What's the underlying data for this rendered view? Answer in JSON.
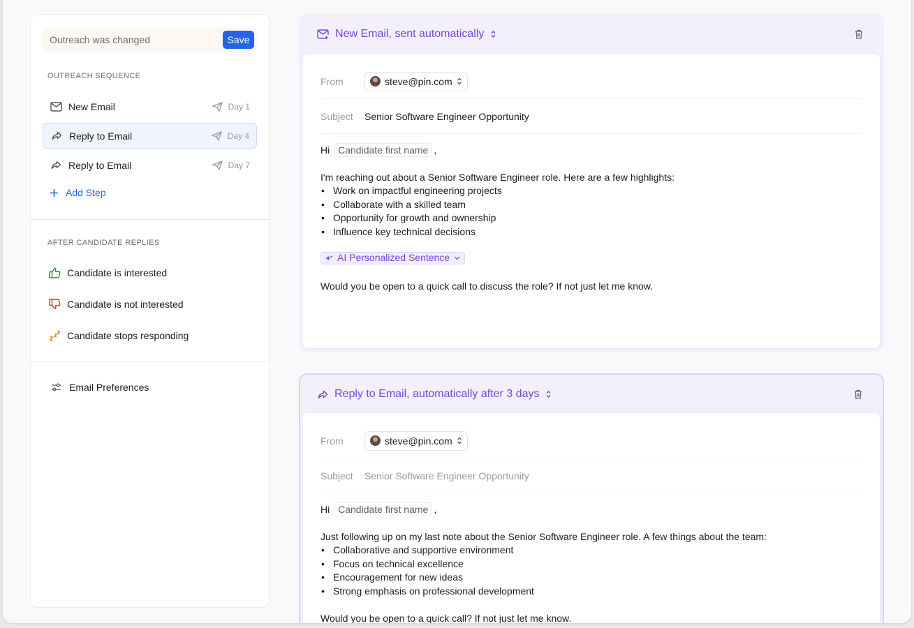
{
  "sidebar": {
    "change_notice": "Outreach was changed",
    "save_label": "Save",
    "sequence_heading": "OUTREACH SEQUENCE",
    "steps": [
      {
        "label": "New Email",
        "day": "Day 1"
      },
      {
        "label": "Reply to Email",
        "day": "Day 4"
      },
      {
        "label": "Reply to Email",
        "day": "Day 7"
      }
    ],
    "add_step_label": "Add Step",
    "replies_heading": "AFTER CANDIDATE REPLIES",
    "replies": [
      {
        "label": "Candidate is interested"
      },
      {
        "label": "Candidate is not interested"
      },
      {
        "label": "Candidate stops responding"
      }
    ],
    "preferences_label": "Email Preferences"
  },
  "cards": [
    {
      "title": "New Email, sent automatically",
      "from_label": "From",
      "from_value": "steve@pin.com",
      "subject_label": "Subject",
      "subject_value": "Senior Software Engineer Opportunity",
      "greeting": "Hi",
      "variable": "Candidate first name",
      "comma": ",",
      "intro": "I'm reaching out about a Senior Software Engineer role. Here are a few highlights:",
      "bullets": [
        "Work on impactful engineering projects",
        "Collaborate with a skilled team",
        "Opportunity for growth and ownership",
        "Influence key technical decisions"
      ],
      "ai_chip": "AI Personalized Sentence",
      "closing": "Would you be open to a quick call to discuss the role? If not just let me know."
    },
    {
      "title": "Reply to Email, automatically after 3 days",
      "from_label": "From",
      "from_value": "steve@pin.com",
      "subject_label": "Subject",
      "subject_value": "Senior Software Engineer Opportunity",
      "greeting": "Hi",
      "variable": "Candidate first name",
      "comma": ",",
      "intro": "Just following up on my last note about the Senior Software Engineer role. A few things about the team:",
      "bullets": [
        "Collaborative and supportive environment",
        "Focus on technical excellence",
        "Encouragement for new ideas",
        "Strong emphasis on professional development"
      ],
      "closing": "Would you be open to a quick call? If not just let me know."
    }
  ],
  "colors": {
    "accent_blue": "#2463eb",
    "accent_purple": "#7246d8",
    "positive": "#1f8f3a",
    "negative": "#d93025",
    "snooze": "#e08a0b"
  }
}
